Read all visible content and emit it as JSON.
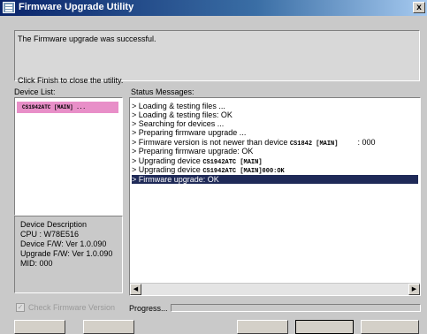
{
  "window": {
    "title": "Firmware Upgrade Utility",
    "close_glyph": "x"
  },
  "message": {
    "line1": "The Firmware upgrade was successful.",
    "line2": "Click Finish to close the utility."
  },
  "device_list": {
    "label": "Device List:",
    "items": [
      {
        "label": "CS1942ATC [MAIN] ...",
        "selected": true
      }
    ]
  },
  "device_description": {
    "title": "Device Description",
    "cpu": "CPU : W78E516",
    "device_fw": "Device F/W: Ver 1.0.090",
    "upgrade_fw": "Upgrade F/W: Ver 1.0.090",
    "mid": "MID: 000"
  },
  "status": {
    "label": "Status Messages:",
    "lines": [
      {
        "text": "> Loading & testing files ..."
      },
      {
        "text": "> Loading & testing files: OK"
      },
      {
        "text": "> Searching for devices ..."
      },
      {
        "text": "> Preparing firmware upgrade ..."
      },
      {
        "text": "> Firmware version is not newer than device",
        "device": "CS1842 [MAIN]",
        "suffix": ": 000"
      },
      {
        "text": "> Preparing firmware upgrade: OK"
      },
      {
        "text": "> Upgrading device",
        "device": "CS1942ATC [MAIN]"
      },
      {
        "text": "> Upgrading device",
        "device": "CS1942ATC [MAIN]000:OK"
      },
      {
        "text": "> Firmware upgrade: OK",
        "selected": true
      }
    ]
  },
  "bottom": {
    "check_label": "Check Firmware Version",
    "check_glyph": "✓",
    "progress_label": "Progress..."
  },
  "icons": {
    "scroll_left": "◀",
    "scroll_right": "▶"
  },
  "colors": {
    "title_bar": "#0a246a",
    "selected_device": "#e88fc8",
    "selected_status": "#1f2a58"
  }
}
